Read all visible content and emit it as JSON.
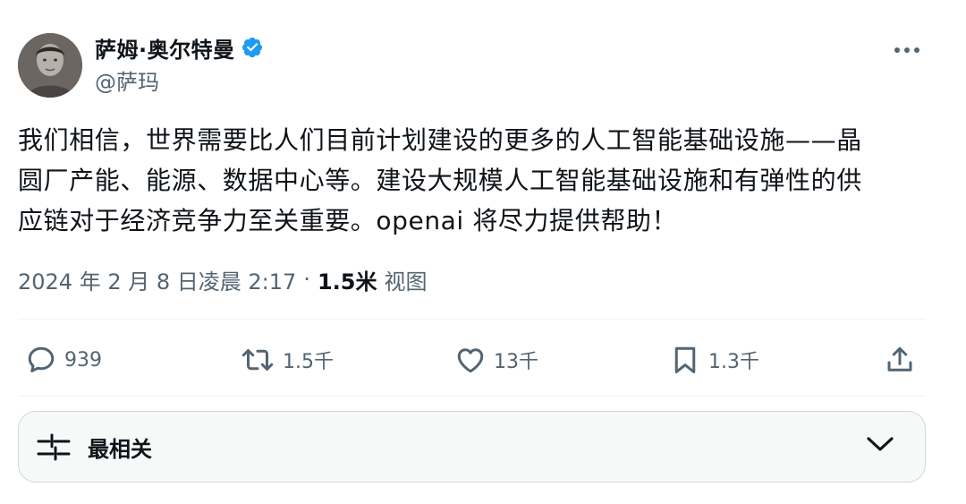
{
  "author": {
    "display_name": "萨姆·奥尔特曼",
    "handle": "@萨玛",
    "verified_color": "#1d9bf0"
  },
  "tweet": {
    "lines": [
      "我们相信，世界需要比人们目前计划建设的更多的人工智能基础设施——晶",
      "圆厂产能、能源、数据中心等。建设大规模人工智能基础设施和有弹性的供",
      "应链对于经济竞争力至关重要。openai 将尽力提供帮助！"
    ],
    "timestamp": "2024 年 2 月 8 日凌晨 2:17",
    "separator": "·",
    "views_count": "1.5米",
    "views_label": "视图"
  },
  "actions": {
    "replies": {
      "icon": "reply-icon",
      "count": "939"
    },
    "reposts": {
      "icon": "repost-icon",
      "count": "1.5千"
    },
    "likes": {
      "icon": "heart-icon",
      "count": "13千"
    },
    "bookmarks": {
      "icon": "bookmark-icon",
      "count": "1.3千"
    },
    "share": {
      "icon": "share-icon"
    }
  },
  "sort": {
    "label": "最相关",
    "icon": "sort-sliders-icon",
    "chevron": "chevron-down-icon"
  },
  "colors": {
    "text_primary": "#0f1419",
    "text_secondary": "#536471",
    "divider": "#eff3f4",
    "accent": "#1d9bf0"
  }
}
